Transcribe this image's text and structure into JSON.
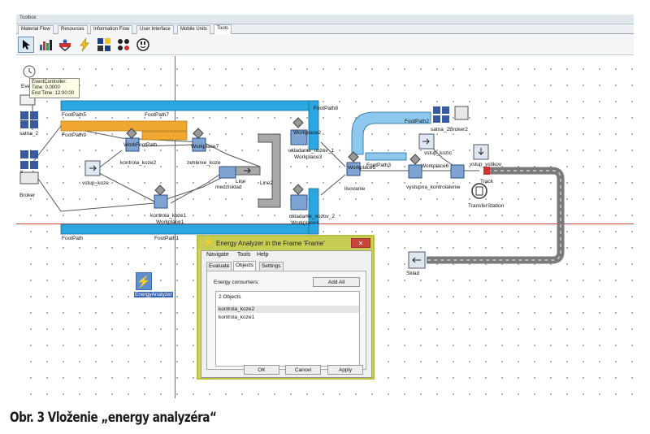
{
  "toolbox": {
    "title": "Toolbox",
    "tabs": [
      "Material Flow",
      "Resources",
      "Information Flow",
      "User Interface",
      "Mobile Units",
      "Tools"
    ],
    "active_tab": "Tools"
  },
  "tooltip": {
    "line1": "EventController:",
    "line2": "Time: 0.0000",
    "line3": "End Time: 12:00:00"
  },
  "model_labels": {
    "event_ctrl": "Even",
    "satna2": "satna_2",
    "broker": "Broker",
    "broker_s": "s",
    "footpath5": "FootPath5",
    "footpath7": "FootPath7",
    "footpath8": "FootPath8",
    "footpath9": "FootPath9",
    "footpath": "FootPath",
    "footpath1": "FootPath1",
    "footpath2": "FootPath2",
    "footpath3": "FootPath3",
    "workfootpath": "WorkFootPath",
    "workplace7": "Workplace7",
    "kontrola_koze2": "kontrola_koze2",
    "zehlenie": "zehlenie_koze",
    "vstup_koze": "vstup_koze",
    "medzisklad": "medzisklad",
    "line": "Line",
    "line2": "Line2",
    "workplace2": "Workplace2",
    "ukladanie_nozov1": "ukladanie_nozov_1",
    "workplace3": "Workplace3",
    "kontrola_koze1": "kontrola_koze1",
    "workplace1": "Workplace1",
    "ukladanie_nozov2": "ukladanie_nozov_2",
    "workplace4": "Workplace4",
    "lisovanie": "lisovanie",
    "workplace5": "Workplace5",
    "satna_broker2": "satna_2Broker2",
    "vstup_kozic": "vstup_kozic",
    "workplace6": "Workplace6",
    "vystupna_kontrola": "vystupna_kontrolalenie",
    "vstup_vstikov": "vstup_vstikov",
    "track": "Track",
    "transferstation": "TransferStation",
    "sklad": "Sklad",
    "energyanalyzer": "EnergyAnalyzer"
  },
  "dialog": {
    "title": "Energy Analyzer in the Frame 'Frame'",
    "menu": [
      "Navigate",
      "Tools",
      "Help"
    ],
    "tabs": [
      "Evaluate",
      "Objects",
      "Settings"
    ],
    "active_tab": "Objects",
    "consumers_label": "Energy consumers:",
    "add_all": "Add All",
    "list_header": "2 Objects",
    "list_items": [
      "kontrola_koze2",
      "kontrola_koze1"
    ],
    "ok": "OK",
    "cancel": "Cancel",
    "apply": "Apply",
    "close_glyph": "✕"
  },
  "colors": {
    "footpath_blue": "#2aa7e0",
    "workfootpath_orange": "#f0a830",
    "track_gray": "#8a8a8a",
    "line_gray": "#a8a8a8",
    "dialog_frame": "#cdd45c"
  },
  "caption": "Obr. 3 Vloženie „energy analyzéra“"
}
